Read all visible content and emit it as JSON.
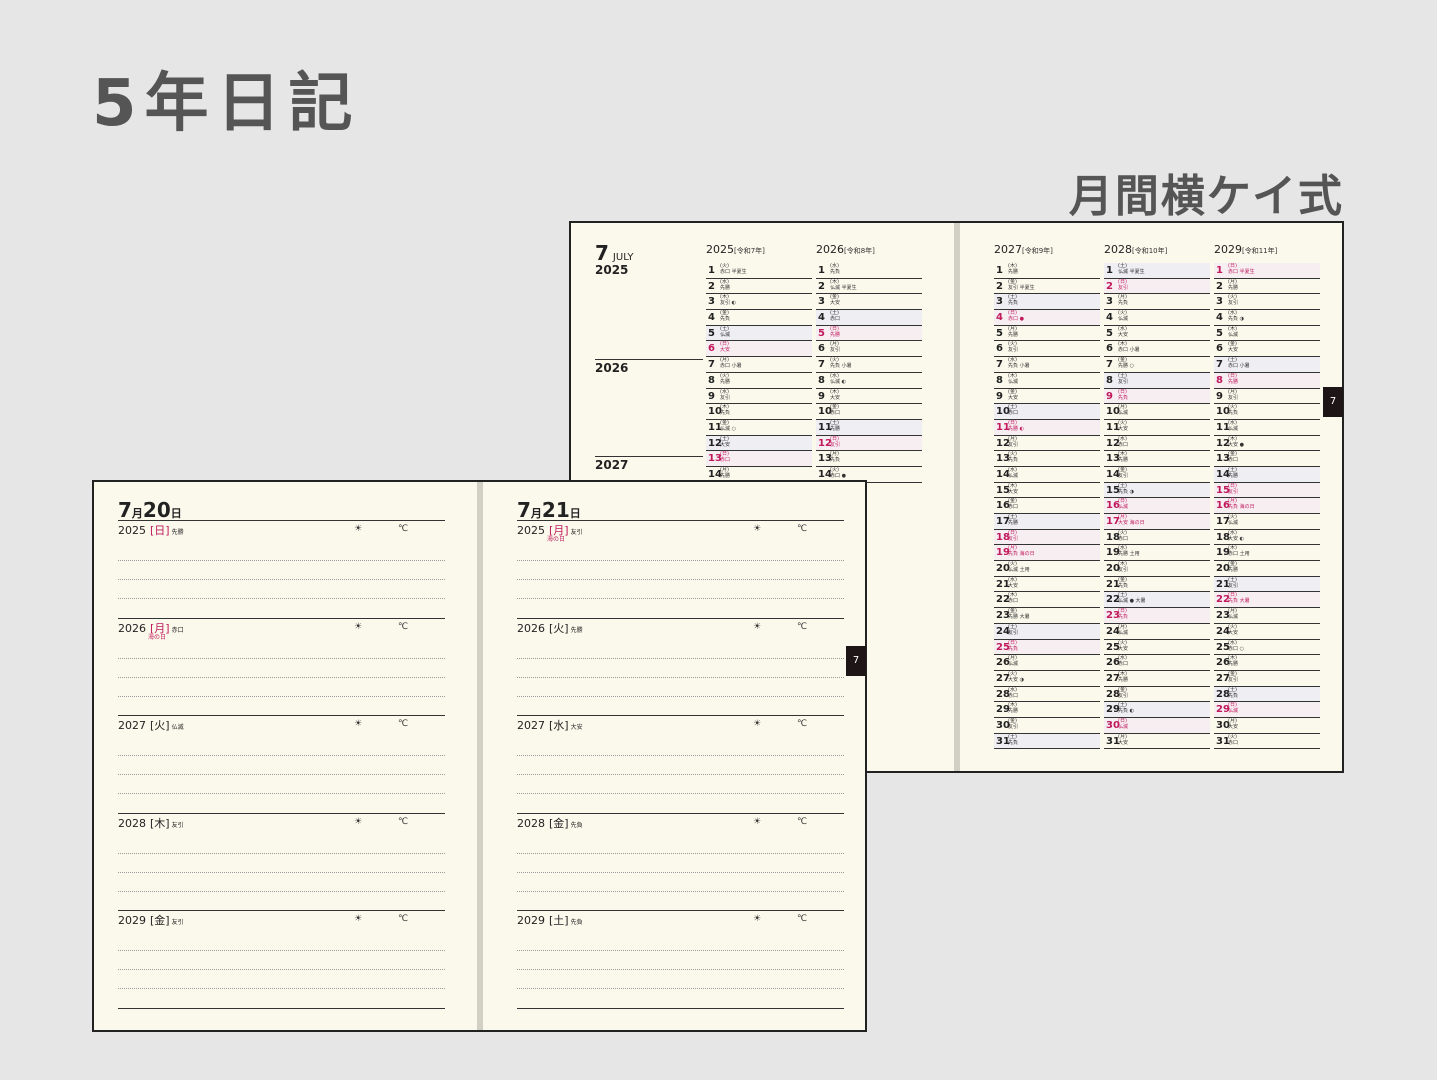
{
  "title": "5年日記",
  "subtitle": "月間横ケイ式",
  "monthly": {
    "month": "7",
    "month_en": "JULY",
    "tab": "7",
    "year_labels": [
      "2025",
      "2026",
      "2027"
    ],
    "columns": [
      {
        "year": "2025",
        "era": "[令和7年]",
        "days": [
          {
            "d": "1",
            "w": "(火)",
            "r": "赤口 半夏生"
          },
          {
            "d": "2",
            "w": "(水)",
            "r": "先勝"
          },
          {
            "d": "3",
            "w": "(木)",
            "r": "友引 ◐"
          },
          {
            "d": "4",
            "w": "(金)",
            "r": "先負"
          },
          {
            "d": "5",
            "w": "(土)",
            "r": "仏滅",
            "s": 1
          },
          {
            "d": "6",
            "w": "(日)",
            "r": "大安",
            "h": 1
          },
          {
            "d": "7",
            "w": "(月)",
            "r": "赤口 小暑"
          },
          {
            "d": "8",
            "w": "(火)",
            "r": "先勝"
          },
          {
            "d": "9",
            "w": "(水)",
            "r": "友引"
          },
          {
            "d": "10",
            "w": "(木)",
            "r": "先負"
          },
          {
            "d": "11",
            "w": "(金)",
            "r": "仏滅 ○"
          },
          {
            "d": "12",
            "w": "(土)",
            "r": "大安",
            "s": 1
          },
          {
            "d": "13",
            "w": "(日)",
            "r": "赤口",
            "h": 1
          },
          {
            "d": "14",
            "w": "(月)",
            "r": "先勝"
          }
        ]
      },
      {
        "year": "2026",
        "era": "[令和8年]",
        "days": [
          {
            "d": "1",
            "w": "(水)",
            "r": "先負"
          },
          {
            "d": "2",
            "w": "(木)",
            "r": "仏滅 半夏生"
          },
          {
            "d": "3",
            "w": "(金)",
            "r": "大安"
          },
          {
            "d": "4",
            "w": "(土)",
            "r": "赤口",
            "s": 1
          },
          {
            "d": "5",
            "w": "(日)",
            "r": "先勝",
            "h": 1
          },
          {
            "d": "6",
            "w": "(月)",
            "r": "友引"
          },
          {
            "d": "7",
            "w": "(火)",
            "r": "先負 小暑"
          },
          {
            "d": "8",
            "w": "(水)",
            "r": "仏滅 ◐"
          },
          {
            "d": "9",
            "w": "(木)",
            "r": "大安"
          },
          {
            "d": "10",
            "w": "(金)",
            "r": "赤口"
          },
          {
            "d": "11",
            "w": "(土)",
            "r": "先勝",
            "s": 1
          },
          {
            "d": "12",
            "w": "(日)",
            "r": "友引",
            "h": 1
          },
          {
            "d": "13",
            "w": "(月)",
            "r": "先負"
          },
          {
            "d": "14",
            "w": "(火)",
            "r": "赤口 ●"
          }
        ]
      },
      {
        "year": "2027",
        "era": "[令和9年]",
        "days": [
          {
            "d": "1",
            "w": "(木)",
            "r": "先勝"
          },
          {
            "d": "2",
            "w": "(金)",
            "r": "友引 半夏生"
          },
          {
            "d": "3",
            "w": "(土)",
            "r": "先負",
            "s": 1
          },
          {
            "d": "4",
            "w": "(日)",
            "r": "赤口 ●",
            "h": 1
          },
          {
            "d": "5",
            "w": "(月)",
            "r": "先勝"
          },
          {
            "d": "6",
            "w": "(火)",
            "r": "友引"
          },
          {
            "d": "7",
            "w": "(水)",
            "r": "先負 小暑"
          },
          {
            "d": "8",
            "w": "(木)",
            "r": "仏滅"
          },
          {
            "d": "9",
            "w": "(金)",
            "r": "大安"
          },
          {
            "d": "10",
            "w": "(土)",
            "r": "赤口",
            "s": 1
          },
          {
            "d": "11",
            "w": "(日)",
            "r": "先勝 ◐",
            "h": 1
          },
          {
            "d": "12",
            "w": "(月)",
            "r": "友引"
          },
          {
            "d": "13",
            "w": "(火)",
            "r": "先負"
          },
          {
            "d": "14",
            "w": "(水)",
            "r": "仏滅"
          },
          {
            "d": "15",
            "w": "(木)",
            "r": "大安"
          },
          {
            "d": "16",
            "w": "(金)",
            "r": "赤口"
          },
          {
            "d": "17",
            "w": "(土)",
            "r": "先勝",
            "s": 1
          },
          {
            "d": "18",
            "w": "(日)",
            "r": "友引",
            "h": 1
          },
          {
            "d": "19",
            "w": "(月)",
            "r": "先負 海の日",
            "h": 1
          },
          {
            "d": "20",
            "w": "(火)",
            "r": "仏滅 土用"
          },
          {
            "d": "21",
            "w": "(水)",
            "r": "大安"
          },
          {
            "d": "22",
            "w": "(木)",
            "r": "赤口"
          },
          {
            "d": "23",
            "w": "(金)",
            "r": "先勝 大暑"
          },
          {
            "d": "24",
            "w": "(土)",
            "r": "友引",
            "s": 1
          },
          {
            "d": "25",
            "w": "(日)",
            "r": "先負",
            "h": 1
          },
          {
            "d": "26",
            "w": "(月)",
            "r": "仏滅"
          },
          {
            "d": "27",
            "w": "(火)",
            "r": "大安 ◑"
          },
          {
            "d": "28",
            "w": "(水)",
            "r": "赤口"
          },
          {
            "d": "29",
            "w": "(木)",
            "r": "先勝"
          },
          {
            "d": "30",
            "w": "(金)",
            "r": "友引"
          },
          {
            "d": "31",
            "w": "(土)",
            "r": "先負",
            "s": 1
          }
        ]
      },
      {
        "year": "2028",
        "era": "[令和10年]",
        "days": [
          {
            "d": "1",
            "w": "(土)",
            "r": "仏滅 半夏生",
            "s": 1
          },
          {
            "d": "2",
            "w": "(日)",
            "r": "友引",
            "h": 1
          },
          {
            "d": "3",
            "w": "(月)",
            "r": "先負"
          },
          {
            "d": "4",
            "w": "(火)",
            "r": "仏滅"
          },
          {
            "d": "5",
            "w": "(水)",
            "r": "大安"
          },
          {
            "d": "6",
            "w": "(木)",
            "r": "赤口 小暑"
          },
          {
            "d": "7",
            "w": "(金)",
            "r": "先勝 ○"
          },
          {
            "d": "8",
            "w": "(土)",
            "r": "友引",
            "s": 1
          },
          {
            "d": "9",
            "w": "(日)",
            "r": "先負",
            "h": 1
          },
          {
            "d": "10",
            "w": "(月)",
            "r": "仏滅"
          },
          {
            "d": "11",
            "w": "(火)",
            "r": "大安"
          },
          {
            "d": "12",
            "w": "(水)",
            "r": "赤口"
          },
          {
            "d": "13",
            "w": "(木)",
            "r": "先勝"
          },
          {
            "d": "14",
            "w": "(金)",
            "r": "友引"
          },
          {
            "d": "15",
            "w": "(土)",
            "r": "先負 ◑",
            "s": 1
          },
          {
            "d": "16",
            "w": "(日)",
            "r": "仏滅",
            "h": 1
          },
          {
            "d": "17",
            "w": "(月)",
            "r": "大安 海の日",
            "h": 1
          },
          {
            "d": "18",
            "w": "(火)",
            "r": "赤口"
          },
          {
            "d": "19",
            "w": "(水)",
            "r": "先勝 土用"
          },
          {
            "d": "20",
            "w": "(木)",
            "r": "友引"
          },
          {
            "d": "21",
            "w": "(金)",
            "r": "先負"
          },
          {
            "d": "22",
            "w": "(土)",
            "r": "仏滅 ● 大暑",
            "s": 1
          },
          {
            "d": "23",
            "w": "(日)",
            "r": "先負",
            "h": 1
          },
          {
            "d": "24",
            "w": "(月)",
            "r": "仏滅"
          },
          {
            "d": "25",
            "w": "(火)",
            "r": "大安"
          },
          {
            "d": "26",
            "w": "(水)",
            "r": "赤口"
          },
          {
            "d": "27",
            "w": "(木)",
            "r": "先勝"
          },
          {
            "d": "28",
            "w": "(金)",
            "r": "友引"
          },
          {
            "d": "29",
            "w": "(土)",
            "r": "先負 ◐",
            "s": 1
          },
          {
            "d": "30",
            "w": "(日)",
            "r": "仏滅",
            "h": 1
          },
          {
            "d": "31",
            "w": "(月)",
            "r": "大安"
          }
        ]
      },
      {
        "year": "2029",
        "era": "[令和11年]",
        "days": [
          {
            "d": "1",
            "w": "(日)",
            "r": "赤口 半夏生",
            "h": 1
          },
          {
            "d": "2",
            "w": "(月)",
            "r": "先勝"
          },
          {
            "d": "3",
            "w": "(火)",
            "r": "友引"
          },
          {
            "d": "4",
            "w": "(水)",
            "r": "先負 ◑"
          },
          {
            "d": "5",
            "w": "(木)",
            "r": "仏滅"
          },
          {
            "d": "6",
            "w": "(金)",
            "r": "大安"
          },
          {
            "d": "7",
            "w": "(土)",
            "r": "赤口 小暑",
            "s": 1
          },
          {
            "d": "8",
            "w": "(日)",
            "r": "先勝",
            "h": 1
          },
          {
            "d": "9",
            "w": "(月)",
            "r": "友引"
          },
          {
            "d": "10",
            "w": "(火)",
            "r": "先負"
          },
          {
            "d": "11",
            "w": "(水)",
            "r": "仏滅"
          },
          {
            "d": "12",
            "w": "(木)",
            "r": "大安 ●"
          },
          {
            "d": "13",
            "w": "(金)",
            "r": "赤口"
          },
          {
            "d": "14",
            "w": "(土)",
            "r": "先勝",
            "s": 1
          },
          {
            "d": "15",
            "w": "(日)",
            "r": "友引",
            "h": 1
          },
          {
            "d": "16",
            "w": "(月)",
            "r": "先負 海の日",
            "h": 1
          },
          {
            "d": "17",
            "w": "(火)",
            "r": "仏滅"
          },
          {
            "d": "18",
            "w": "(水)",
            "r": "大安 ◐"
          },
          {
            "d": "19",
            "w": "(木)",
            "r": "赤口 土用"
          },
          {
            "d": "20",
            "w": "(金)",
            "r": "先勝"
          },
          {
            "d": "21",
            "w": "(土)",
            "r": "友引",
            "s": 1
          },
          {
            "d": "22",
            "w": "(日)",
            "r": "先負 大暑",
            "h": 1
          },
          {
            "d": "23",
            "w": "(月)",
            "r": "仏滅"
          },
          {
            "d": "24",
            "w": "(火)",
            "r": "大安"
          },
          {
            "d": "25",
            "w": "(水)",
            "r": "赤口 ○"
          },
          {
            "d": "26",
            "w": "(木)",
            "r": "先勝"
          },
          {
            "d": "27",
            "w": "(金)",
            "r": "友引"
          },
          {
            "d": "28",
            "w": "(土)",
            "r": "先負",
            "s": 1
          },
          {
            "d": "29",
            "w": "(日)",
            "r": "仏滅",
            "h": 1
          },
          {
            "d": "30",
            "w": "(月)",
            "r": "大安"
          },
          {
            "d": "31",
            "w": "(火)",
            "r": "赤口"
          }
        ]
      }
    ]
  },
  "daily": {
    "tab": "7",
    "pages": [
      {
        "title_month": "7",
        "title_day": "20",
        "entries": [
          {
            "year": "2025",
            "w": "[日]",
            "r": "先勝",
            "red": 1,
            "hol": ""
          },
          {
            "year": "2026",
            "w": "[月]",
            "r": "赤口",
            "red": 1,
            "hol": "海の日"
          },
          {
            "year": "2027",
            "w": "[火]",
            "r": "仏滅",
            "red": 0,
            "hol": ""
          },
          {
            "year": "2028",
            "w": "[木]",
            "r": "友引",
            "red": 0,
            "hol": ""
          },
          {
            "year": "2029",
            "w": "[金]",
            "r": "友引",
            "red": 0,
            "hol": ""
          }
        ]
      },
      {
        "title_month": "7",
        "title_day": "21",
        "entries": [
          {
            "year": "2025",
            "w": "[月]",
            "r": "友引",
            "red": 1,
            "hol": "海の日"
          },
          {
            "year": "2026",
            "w": "[火]",
            "r": "先勝",
            "red": 0,
            "hol": ""
          },
          {
            "year": "2027",
            "w": "[水]",
            "r": "大安",
            "red": 0,
            "hol": ""
          },
          {
            "year": "2028",
            "w": "[金]",
            "r": "先負",
            "red": 0,
            "hol": ""
          },
          {
            "year": "2029",
            "w": "[土]",
            "r": "先負",
            "red": 0,
            "hol": ""
          }
        ]
      }
    ],
    "weather_icon": "☀",
    "temp_icon": "℃"
  }
}
